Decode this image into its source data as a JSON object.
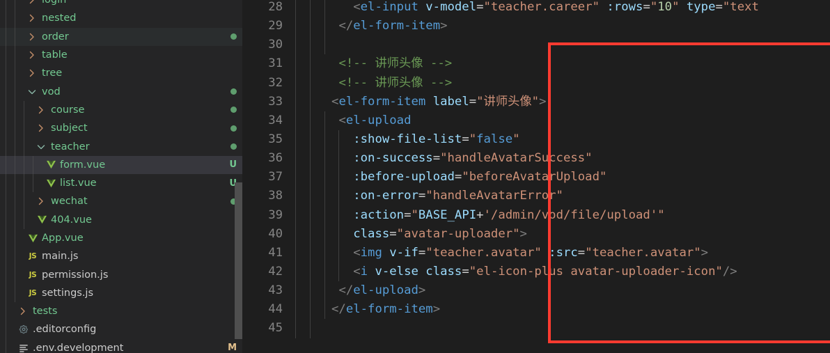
{
  "sidebar": {
    "scrollbar_visible": true,
    "items": [
      {
        "name": "login",
        "kind": "folder",
        "depth": 2,
        "expanded": false,
        "icon": "chevron-right-icon",
        "badge": "",
        "dot": false,
        "selected": false,
        "highlight": false,
        "clipped_top": true
      },
      {
        "name": "nested",
        "kind": "folder",
        "depth": 2,
        "expanded": false,
        "icon": "chevron-right-icon",
        "badge": "",
        "dot": false,
        "selected": false,
        "highlight": false
      },
      {
        "name": "order",
        "kind": "folder",
        "depth": 2,
        "expanded": false,
        "icon": "chevron-right-icon",
        "badge": "",
        "dot": true,
        "selected": false,
        "highlight": true
      },
      {
        "name": "table",
        "kind": "folder",
        "depth": 2,
        "expanded": false,
        "icon": "chevron-right-icon",
        "badge": "",
        "dot": false,
        "selected": false,
        "highlight": false
      },
      {
        "name": "tree",
        "kind": "folder",
        "depth": 2,
        "expanded": false,
        "icon": "chevron-right-icon",
        "badge": "",
        "dot": false,
        "selected": false,
        "highlight": false
      },
      {
        "name": "vod",
        "kind": "folder",
        "depth": 2,
        "expanded": true,
        "icon": "chevron-down-icon",
        "badge": "",
        "dot": true,
        "selected": false,
        "highlight": false
      },
      {
        "name": "course",
        "kind": "folder",
        "depth": 3,
        "expanded": false,
        "icon": "chevron-right-icon",
        "badge": "",
        "dot": true,
        "selected": false,
        "highlight": false
      },
      {
        "name": "subject",
        "kind": "folder",
        "depth": 3,
        "expanded": false,
        "icon": "chevron-right-icon",
        "badge": "",
        "dot": true,
        "selected": false,
        "highlight": false
      },
      {
        "name": "teacher",
        "kind": "folder",
        "depth": 3,
        "expanded": true,
        "icon": "chevron-down-icon",
        "badge": "",
        "dot": true,
        "selected": false,
        "highlight": false
      },
      {
        "name": "form.vue",
        "kind": "vue",
        "depth": 4,
        "expanded": null,
        "icon": "vue-file-icon",
        "badge": "U",
        "dot": false,
        "selected": true,
        "highlight": false
      },
      {
        "name": "list.vue",
        "kind": "vue",
        "depth": 4,
        "expanded": null,
        "icon": "vue-file-icon",
        "badge": "U",
        "dot": false,
        "selected": false,
        "highlight": false
      },
      {
        "name": "wechat",
        "kind": "folder",
        "depth": 3,
        "expanded": false,
        "icon": "chevron-right-icon",
        "badge": "",
        "dot": true,
        "selected": false,
        "highlight": false
      },
      {
        "name": "404.vue",
        "kind": "vue",
        "depth": 3,
        "expanded": null,
        "icon": "vue-file-icon",
        "badge": "",
        "dot": false,
        "selected": false,
        "highlight": false
      },
      {
        "name": "App.vue",
        "kind": "vue",
        "depth": 2,
        "expanded": null,
        "icon": "vue-file-icon",
        "badge": "",
        "dot": false,
        "selected": false,
        "highlight": false
      },
      {
        "name": "main.js",
        "kind": "js",
        "depth": 2,
        "expanded": null,
        "icon": "js-file-icon",
        "badge": "",
        "dot": false,
        "selected": false,
        "highlight": false
      },
      {
        "name": "permission.js",
        "kind": "js",
        "depth": 2,
        "expanded": null,
        "icon": "js-file-icon",
        "badge": "",
        "dot": false,
        "selected": false,
        "highlight": false
      },
      {
        "name": "settings.js",
        "kind": "js",
        "depth": 2,
        "expanded": null,
        "icon": "js-file-icon",
        "badge": "",
        "dot": false,
        "selected": false,
        "highlight": false
      },
      {
        "name": "tests",
        "kind": "folder",
        "depth": 1,
        "expanded": false,
        "icon": "chevron-right-icon",
        "badge": "",
        "dot": false,
        "selected": false,
        "highlight": false
      },
      {
        "name": ".editorconfig",
        "kind": "config",
        "depth": 1,
        "expanded": null,
        "icon": "gear-icon",
        "badge": "",
        "dot": false,
        "selected": false,
        "highlight": false
      },
      {
        "name": ".env.development",
        "kind": "env",
        "depth": 1,
        "expanded": null,
        "icon": "settings-lines-icon",
        "badge": "M",
        "dot": false,
        "selected": false,
        "highlight": false,
        "clipped_bottom": true
      }
    ]
  },
  "editor": {
    "first_line_number": 28,
    "lines": [
      {
        "num": 28,
        "indent_guides": 3,
        "tokens": [
          {
            "t": "        ",
            "c": "t-plain"
          },
          {
            "t": "<",
            "c": "t-angle"
          },
          {
            "t": "el-input",
            "c": "t-tag"
          },
          {
            "t": " ",
            "c": "t-plain"
          },
          {
            "t": "v-model",
            "c": "t-attr"
          },
          {
            "t": "=",
            "c": "t-op"
          },
          {
            "t": "\"teacher.career\"",
            "c": "t-str"
          },
          {
            "t": " ",
            "c": "t-plain"
          },
          {
            "t": ":rows",
            "c": "t-attr"
          },
          {
            "t": "=",
            "c": "t-op"
          },
          {
            "t": "\"",
            "c": "t-str"
          },
          {
            "t": "10",
            "c": "t-num"
          },
          {
            "t": "\"",
            "c": "t-str"
          },
          {
            "t": " ",
            "c": "t-plain"
          },
          {
            "t": "type",
            "c": "t-attr"
          },
          {
            "t": "=",
            "c": "t-op"
          },
          {
            "t": "\"text",
            "c": "t-str"
          }
        ]
      },
      {
        "num": 29,
        "indent_guides": 3,
        "tokens": [
          {
            "t": "      ",
            "c": "t-plain"
          },
          {
            "t": "</",
            "c": "t-angle"
          },
          {
            "t": "el-form-item",
            "c": "t-tag"
          },
          {
            "t": ">",
            "c": "t-angle"
          }
        ]
      },
      {
        "num": 30,
        "indent_guides": 3,
        "tokens": []
      },
      {
        "num": 31,
        "indent_guides": 2,
        "tokens": [
          {
            "t": "      ",
            "c": "t-plain"
          },
          {
            "t": "<!-- 讲师头像 -->",
            "c": "t-cmt"
          }
        ]
      },
      {
        "num": 32,
        "indent_guides": 2,
        "tokens": [
          {
            "t": "      ",
            "c": "t-plain"
          },
          {
            "t": "<!-- 讲师头像 -->",
            "c": "t-cmt"
          }
        ]
      },
      {
        "num": 33,
        "indent_guides": 2,
        "tokens": [
          {
            "t": "     ",
            "c": "t-plain"
          },
          {
            "t": "<",
            "c": "t-angle"
          },
          {
            "t": "el-form-item",
            "c": "t-tag"
          },
          {
            "t": " ",
            "c": "t-plain"
          },
          {
            "t": "label",
            "c": "t-attr"
          },
          {
            "t": "=",
            "c": "t-op"
          },
          {
            "t": "\"讲师头像\"",
            "c": "t-str"
          },
          {
            "t": ">",
            "c": "t-angle"
          }
        ]
      },
      {
        "num": 34,
        "indent_guides": 3,
        "tokens": [
          {
            "t": "      ",
            "c": "t-plain"
          },
          {
            "t": "<",
            "c": "t-angle"
          },
          {
            "t": "el-upload",
            "c": "t-tag"
          }
        ]
      },
      {
        "num": 35,
        "indent_guides": 4,
        "tokens": [
          {
            "t": "        ",
            "c": "t-plain"
          },
          {
            "t": ":show-file-list",
            "c": "t-attr"
          },
          {
            "t": "=",
            "c": "t-op"
          },
          {
            "t": "\"",
            "c": "t-str"
          },
          {
            "t": "false",
            "c": "t-tag"
          },
          {
            "t": "\"",
            "c": "t-str"
          }
        ]
      },
      {
        "num": 36,
        "indent_guides": 4,
        "tokens": [
          {
            "t": "        ",
            "c": "t-plain"
          },
          {
            "t": ":on-success",
            "c": "t-attr"
          },
          {
            "t": "=",
            "c": "t-op"
          },
          {
            "t": "\"handleAvatarSuccess\"",
            "c": "t-str"
          }
        ]
      },
      {
        "num": 37,
        "indent_guides": 4,
        "tokens": [
          {
            "t": "        ",
            "c": "t-plain"
          },
          {
            "t": ":before-upload",
            "c": "t-attr"
          },
          {
            "t": "=",
            "c": "t-op"
          },
          {
            "t": "\"beforeAvatarUpload\"",
            "c": "t-str"
          }
        ]
      },
      {
        "num": 38,
        "indent_guides": 4,
        "tokens": [
          {
            "t": "        ",
            "c": "t-plain"
          },
          {
            "t": ":on-error",
            "c": "t-attr"
          },
          {
            "t": "=",
            "c": "t-op"
          },
          {
            "t": "\"handleAvatarError\"",
            "c": "t-str"
          }
        ]
      },
      {
        "num": 39,
        "indent_guides": 4,
        "tokens": [
          {
            "t": "        ",
            "c": "t-plain"
          },
          {
            "t": ":action",
            "c": "t-attr"
          },
          {
            "t": "=",
            "c": "t-op"
          },
          {
            "t": "\"",
            "c": "t-str"
          },
          {
            "t": "BASE_API",
            "c": "t-var"
          },
          {
            "t": "+",
            "c": "t-op"
          },
          {
            "t": "'/admin/vod/file/upload'\"",
            "c": "t-str"
          }
        ]
      },
      {
        "num": 40,
        "indent_guides": 4,
        "tokens": [
          {
            "t": "        ",
            "c": "t-plain"
          },
          {
            "t": "class",
            "c": "t-attr"
          },
          {
            "t": "=",
            "c": "t-op"
          },
          {
            "t": "\"avatar-uploader\"",
            "c": "t-str"
          },
          {
            "t": ">",
            "c": "t-angle"
          }
        ]
      },
      {
        "num": 41,
        "indent_guides": 4,
        "tokens": [
          {
            "t": "        ",
            "c": "t-plain"
          },
          {
            "t": "<",
            "c": "t-angle"
          },
          {
            "t": "img",
            "c": "t-tag"
          },
          {
            "t": " ",
            "c": "t-plain"
          },
          {
            "t": "v-if",
            "c": "t-attr"
          },
          {
            "t": "=",
            "c": "t-op"
          },
          {
            "t": "\"teacher.avatar\"",
            "c": "t-str"
          },
          {
            "t": " ",
            "c": "t-plain"
          },
          {
            "t": ":src",
            "c": "t-attr"
          },
          {
            "t": "=",
            "c": "t-op"
          },
          {
            "t": "\"teacher.avatar\"",
            "c": "t-str"
          },
          {
            "t": ">",
            "c": "t-angle"
          }
        ]
      },
      {
        "num": 42,
        "indent_guides": 4,
        "tokens": [
          {
            "t": "        ",
            "c": "t-plain"
          },
          {
            "t": "<",
            "c": "t-angle"
          },
          {
            "t": "i",
            "c": "t-tag"
          },
          {
            "t": " ",
            "c": "t-plain"
          },
          {
            "t": "v-else",
            "c": "t-attr"
          },
          {
            "t": " ",
            "c": "t-plain"
          },
          {
            "t": "class",
            "c": "t-attr"
          },
          {
            "t": "=",
            "c": "t-op"
          },
          {
            "t": "\"el-icon-plus avatar-uploader-icon\"",
            "c": "t-str"
          },
          {
            "t": "/>",
            "c": "t-angle"
          }
        ]
      },
      {
        "num": 43,
        "indent_guides": 3,
        "tokens": [
          {
            "t": "      ",
            "c": "t-plain"
          },
          {
            "t": "</",
            "c": "t-angle"
          },
          {
            "t": "el-upload",
            "c": "t-tag"
          },
          {
            "t": ">",
            "c": "t-angle"
          }
        ]
      },
      {
        "num": 44,
        "indent_guides": 3,
        "tokens": [
          {
            "t": "     ",
            "c": "t-plain"
          },
          {
            "t": "</",
            "c": "t-angle"
          },
          {
            "t": "el-form-item",
            "c": "t-tag"
          },
          {
            "t": ">",
            "c": "t-angle"
          }
        ]
      },
      {
        "num": 45,
        "indent_guides": 2,
        "tokens": []
      }
    ]
  },
  "annotation": {
    "shape": "rectangle",
    "color": "#ff3b30",
    "covers_lines": "30-44"
  }
}
